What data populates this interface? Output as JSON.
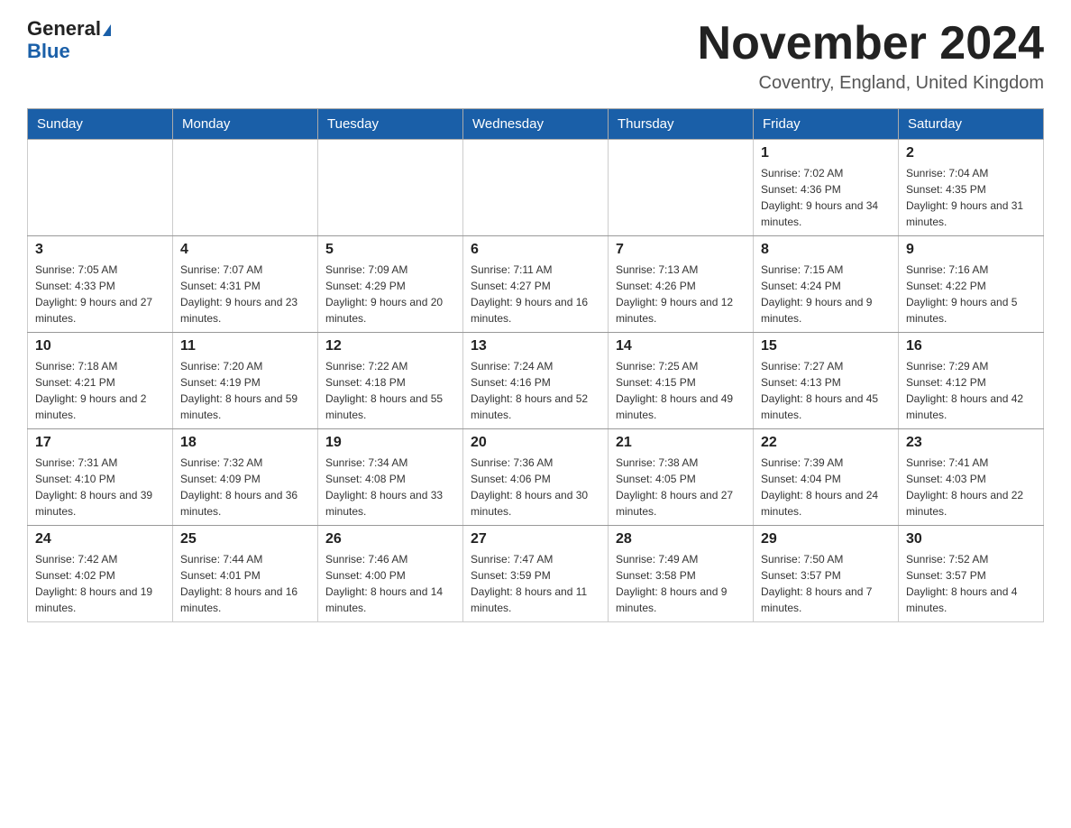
{
  "header": {
    "logo_line1": "General",
    "logo_line2": "Blue",
    "month_title": "November 2024",
    "location": "Coventry, England, United Kingdom"
  },
  "weekdays": [
    "Sunday",
    "Monday",
    "Tuesday",
    "Wednesday",
    "Thursday",
    "Friday",
    "Saturday"
  ],
  "weeks": [
    [
      {
        "day": "",
        "sunrise": "",
        "sunset": "",
        "daylight": ""
      },
      {
        "day": "",
        "sunrise": "",
        "sunset": "",
        "daylight": ""
      },
      {
        "day": "",
        "sunrise": "",
        "sunset": "",
        "daylight": ""
      },
      {
        "day": "",
        "sunrise": "",
        "sunset": "",
        "daylight": ""
      },
      {
        "day": "",
        "sunrise": "",
        "sunset": "",
        "daylight": ""
      },
      {
        "day": "1",
        "sunrise": "Sunrise: 7:02 AM",
        "sunset": "Sunset: 4:36 PM",
        "daylight": "Daylight: 9 hours and 34 minutes."
      },
      {
        "day": "2",
        "sunrise": "Sunrise: 7:04 AM",
        "sunset": "Sunset: 4:35 PM",
        "daylight": "Daylight: 9 hours and 31 minutes."
      }
    ],
    [
      {
        "day": "3",
        "sunrise": "Sunrise: 7:05 AM",
        "sunset": "Sunset: 4:33 PM",
        "daylight": "Daylight: 9 hours and 27 minutes."
      },
      {
        "day": "4",
        "sunrise": "Sunrise: 7:07 AM",
        "sunset": "Sunset: 4:31 PM",
        "daylight": "Daylight: 9 hours and 23 minutes."
      },
      {
        "day": "5",
        "sunrise": "Sunrise: 7:09 AM",
        "sunset": "Sunset: 4:29 PM",
        "daylight": "Daylight: 9 hours and 20 minutes."
      },
      {
        "day": "6",
        "sunrise": "Sunrise: 7:11 AM",
        "sunset": "Sunset: 4:27 PM",
        "daylight": "Daylight: 9 hours and 16 minutes."
      },
      {
        "day": "7",
        "sunrise": "Sunrise: 7:13 AM",
        "sunset": "Sunset: 4:26 PM",
        "daylight": "Daylight: 9 hours and 12 minutes."
      },
      {
        "day": "8",
        "sunrise": "Sunrise: 7:15 AM",
        "sunset": "Sunset: 4:24 PM",
        "daylight": "Daylight: 9 hours and 9 minutes."
      },
      {
        "day": "9",
        "sunrise": "Sunrise: 7:16 AM",
        "sunset": "Sunset: 4:22 PM",
        "daylight": "Daylight: 9 hours and 5 minutes."
      }
    ],
    [
      {
        "day": "10",
        "sunrise": "Sunrise: 7:18 AM",
        "sunset": "Sunset: 4:21 PM",
        "daylight": "Daylight: 9 hours and 2 minutes."
      },
      {
        "day": "11",
        "sunrise": "Sunrise: 7:20 AM",
        "sunset": "Sunset: 4:19 PM",
        "daylight": "Daylight: 8 hours and 59 minutes."
      },
      {
        "day": "12",
        "sunrise": "Sunrise: 7:22 AM",
        "sunset": "Sunset: 4:18 PM",
        "daylight": "Daylight: 8 hours and 55 minutes."
      },
      {
        "day": "13",
        "sunrise": "Sunrise: 7:24 AM",
        "sunset": "Sunset: 4:16 PM",
        "daylight": "Daylight: 8 hours and 52 minutes."
      },
      {
        "day": "14",
        "sunrise": "Sunrise: 7:25 AM",
        "sunset": "Sunset: 4:15 PM",
        "daylight": "Daylight: 8 hours and 49 minutes."
      },
      {
        "day": "15",
        "sunrise": "Sunrise: 7:27 AM",
        "sunset": "Sunset: 4:13 PM",
        "daylight": "Daylight: 8 hours and 45 minutes."
      },
      {
        "day": "16",
        "sunrise": "Sunrise: 7:29 AM",
        "sunset": "Sunset: 4:12 PM",
        "daylight": "Daylight: 8 hours and 42 minutes."
      }
    ],
    [
      {
        "day": "17",
        "sunrise": "Sunrise: 7:31 AM",
        "sunset": "Sunset: 4:10 PM",
        "daylight": "Daylight: 8 hours and 39 minutes."
      },
      {
        "day": "18",
        "sunrise": "Sunrise: 7:32 AM",
        "sunset": "Sunset: 4:09 PM",
        "daylight": "Daylight: 8 hours and 36 minutes."
      },
      {
        "day": "19",
        "sunrise": "Sunrise: 7:34 AM",
        "sunset": "Sunset: 4:08 PM",
        "daylight": "Daylight: 8 hours and 33 minutes."
      },
      {
        "day": "20",
        "sunrise": "Sunrise: 7:36 AM",
        "sunset": "Sunset: 4:06 PM",
        "daylight": "Daylight: 8 hours and 30 minutes."
      },
      {
        "day": "21",
        "sunrise": "Sunrise: 7:38 AM",
        "sunset": "Sunset: 4:05 PM",
        "daylight": "Daylight: 8 hours and 27 minutes."
      },
      {
        "day": "22",
        "sunrise": "Sunrise: 7:39 AM",
        "sunset": "Sunset: 4:04 PM",
        "daylight": "Daylight: 8 hours and 24 minutes."
      },
      {
        "day": "23",
        "sunrise": "Sunrise: 7:41 AM",
        "sunset": "Sunset: 4:03 PM",
        "daylight": "Daylight: 8 hours and 22 minutes."
      }
    ],
    [
      {
        "day": "24",
        "sunrise": "Sunrise: 7:42 AM",
        "sunset": "Sunset: 4:02 PM",
        "daylight": "Daylight: 8 hours and 19 minutes."
      },
      {
        "day": "25",
        "sunrise": "Sunrise: 7:44 AM",
        "sunset": "Sunset: 4:01 PM",
        "daylight": "Daylight: 8 hours and 16 minutes."
      },
      {
        "day": "26",
        "sunrise": "Sunrise: 7:46 AM",
        "sunset": "Sunset: 4:00 PM",
        "daylight": "Daylight: 8 hours and 14 minutes."
      },
      {
        "day": "27",
        "sunrise": "Sunrise: 7:47 AM",
        "sunset": "Sunset: 3:59 PM",
        "daylight": "Daylight: 8 hours and 11 minutes."
      },
      {
        "day": "28",
        "sunrise": "Sunrise: 7:49 AM",
        "sunset": "Sunset: 3:58 PM",
        "daylight": "Daylight: 8 hours and 9 minutes."
      },
      {
        "day": "29",
        "sunrise": "Sunrise: 7:50 AM",
        "sunset": "Sunset: 3:57 PM",
        "daylight": "Daylight: 8 hours and 7 minutes."
      },
      {
        "day": "30",
        "sunrise": "Sunrise: 7:52 AM",
        "sunset": "Sunset: 3:57 PM",
        "daylight": "Daylight: 8 hours and 4 minutes."
      }
    ]
  ]
}
